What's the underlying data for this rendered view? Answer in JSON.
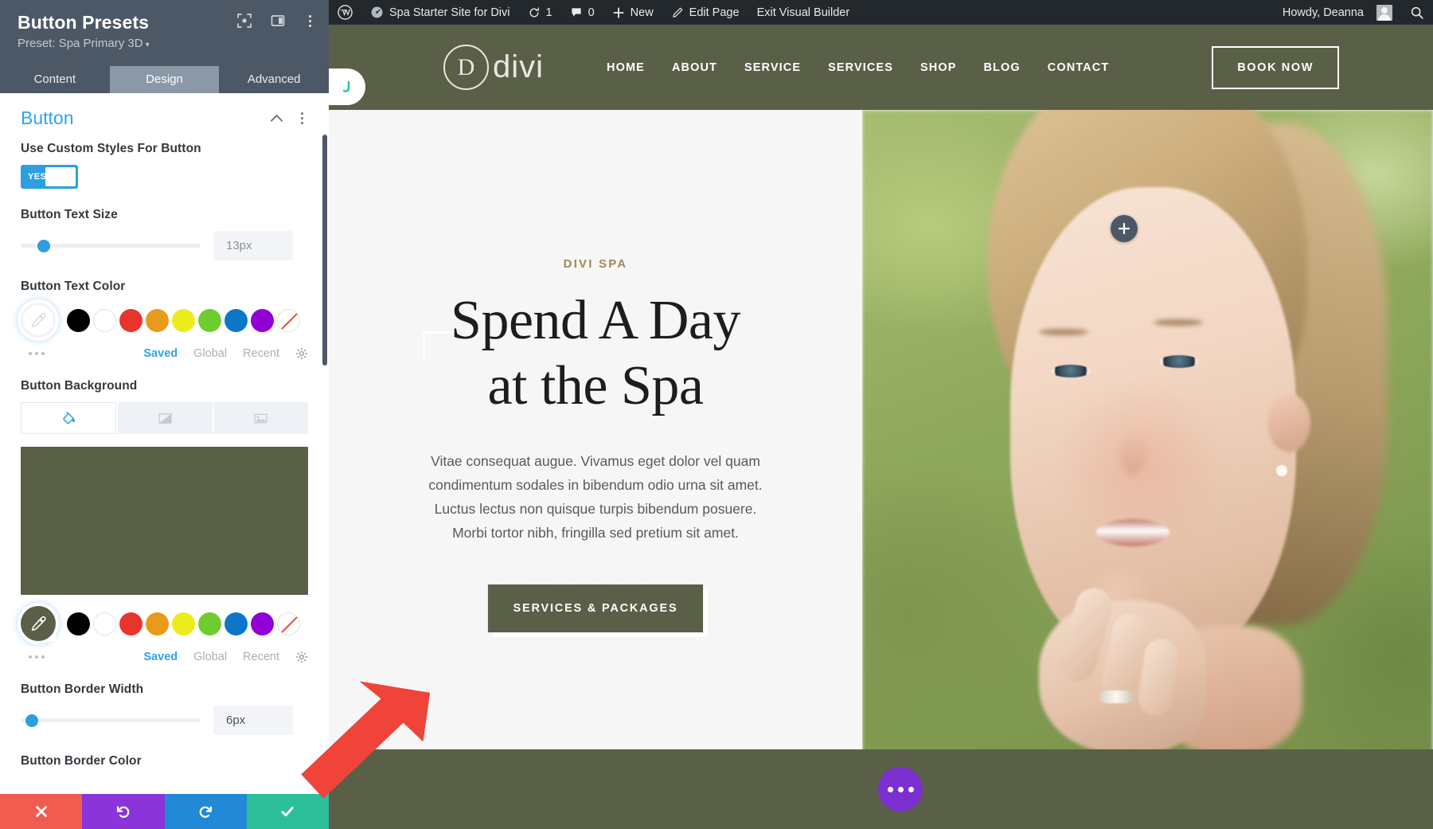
{
  "panel": {
    "title": "Button Presets",
    "subtitle": "Preset: Spa Primary 3D",
    "caret": "▾",
    "header_icons": [
      {
        "name": "focus-icon"
      },
      {
        "name": "layout-columns-icon"
      },
      {
        "name": "more-vertical-icon"
      }
    ],
    "tabs": [
      {
        "label": "Content",
        "active": false
      },
      {
        "label": "Design",
        "active": true
      },
      {
        "label": "Advanced",
        "active": false
      }
    ],
    "section": {
      "title": "Button",
      "collapse_icon": "chevron-up-icon",
      "more_icon": "more-vertical-icon"
    },
    "fields": {
      "use_custom_styles": {
        "label": "Use Custom Styles For Button",
        "toggle_value": "YES"
      },
      "button_text_size": {
        "label": "Button Text Size",
        "value": "13px",
        "slider_percent": 13
      },
      "button_text_color": {
        "label": "Button Text Color",
        "picker_color": "",
        "links": [
          "Saved",
          "Global",
          "Recent"
        ],
        "gear_icon": "gear-icon"
      },
      "button_background": {
        "label": "Button Background",
        "tabs": [
          {
            "name": "background-color-tab",
            "icon": "paint-bucket-icon",
            "active": true
          },
          {
            "name": "background-gradient-tab",
            "icon": "gradient-icon",
            "active": false
          },
          {
            "name": "background-image-tab",
            "icon": "image-icon",
            "active": false
          }
        ],
        "preview_color": "#5a6047",
        "picker_color": "#5a6047",
        "links": [
          "Saved",
          "Global",
          "Recent"
        ],
        "gear_icon": "gear-icon"
      },
      "button_border_width": {
        "label": "Button Border Width",
        "value": "6px",
        "slider_percent": 6
      },
      "button_border_color": {
        "label": "Button Border Color"
      }
    },
    "palette": [
      "#000000",
      "#ffffff",
      "#e8342c",
      "#e89a1c",
      "#ecec1c",
      "#6fcc2e",
      "#0d76c9",
      "#9100d4",
      "none"
    ],
    "actions": [
      {
        "name": "cancel-button",
        "icon": "x-icon",
        "color": "#f05c50"
      },
      {
        "name": "undo-button",
        "icon": "undo-icon",
        "color": "#8b34d9"
      },
      {
        "name": "redo-button",
        "icon": "redo-icon",
        "color": "#2189d6"
      },
      {
        "name": "save-button",
        "icon": "check-icon",
        "color": "#2cbf9a"
      }
    ]
  },
  "wpbar": {
    "logo": "wordpress-icon",
    "site_name": "Spa Starter Site for Divi",
    "updates_count": "1",
    "comments_count": "0",
    "new_label": "New",
    "edit_page_label": "Edit Page",
    "exit_builder_label": "Exit Visual Builder",
    "howdy": "Howdy, Deanna",
    "search_icon": "search-icon"
  },
  "site": {
    "logo_letter": "D",
    "logo_text": "divi",
    "nav": [
      "HOME",
      "ABOUT",
      "SERVICE",
      "SERVICES",
      "SHOP",
      "BLOG",
      "CONTACT"
    ],
    "cta": "BOOK NOW",
    "header_bg": "#5a6047",
    "tab_handle_icon": "divi-tab-icon"
  },
  "hero": {
    "eyebrow": "DIVI SPA",
    "heading_line1": "Spend A Day",
    "heading_line2": "at the Spa",
    "paragraph": "Vitae consequat augue. Vivamus eget dolor vel quam condimentum sodales in bibendum odio urna sit amet. Luctus lectus non quisque turpis bibendum posuere. Morbi tortor nibh, fringilla sed pretium sit amet.",
    "button": "SERVICES & PACKAGES",
    "add_module_icon": "plus-icon",
    "eyebrow_color": "#a08a55",
    "button_bg": "#5a6047"
  },
  "footer": {
    "more_options_icon": "ellipsis-icon",
    "bg": "#5a6047",
    "button_color": "#7b2fd1"
  },
  "annotation": {
    "arrow_color": "#f0433a",
    "name": "pointer-arrow"
  }
}
